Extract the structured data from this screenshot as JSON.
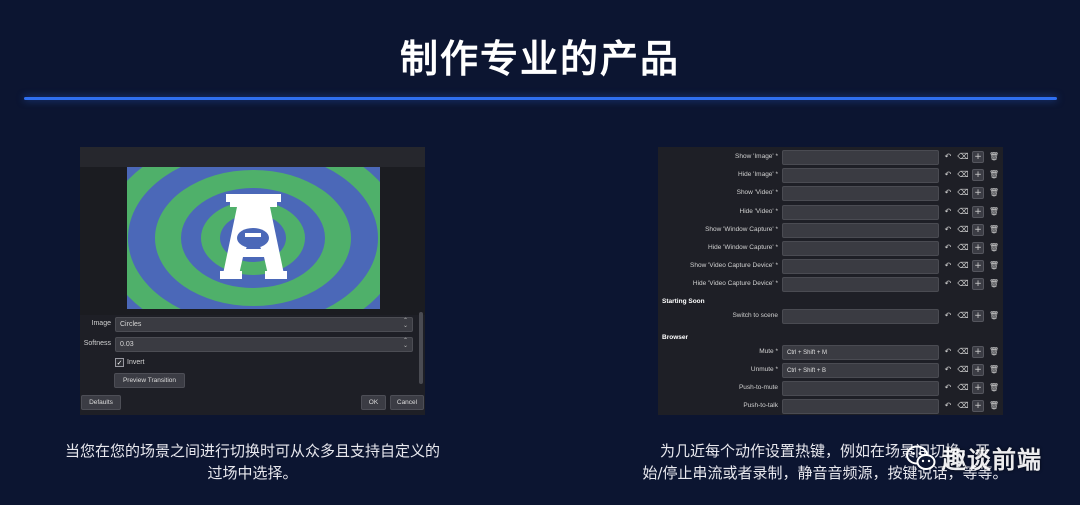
{
  "header": {
    "title": "制作专业的产品"
  },
  "left": {
    "image_label": "Image",
    "image_value": "Circles",
    "softness_label": "Softness",
    "softness_value": "0.03",
    "invert_label": "Invert",
    "invert_checked": true,
    "preview_button": "Preview Transition",
    "defaults_button": "Defaults",
    "ok_button": "OK",
    "cancel_button": "Cancel",
    "caption_line1": "当您在您的场景之间进行切换时可从众多且支持自定义的",
    "caption_line2": "过场中选择。"
  },
  "right": {
    "rows": [
      {
        "label": "Show 'Image' *",
        "value": ""
      },
      {
        "label": "Hide 'Image' *",
        "value": ""
      },
      {
        "label": "Show 'Video' *",
        "value": ""
      },
      {
        "label": "Hide 'Video' *",
        "value": ""
      },
      {
        "label": "Show 'Window Capture' *",
        "value": ""
      },
      {
        "label": "Hide 'Window Capture' *",
        "value": ""
      },
      {
        "label": "Show 'Video Capture Device' *",
        "value": ""
      },
      {
        "label": "Hide 'Video Capture Device' *",
        "value": ""
      }
    ],
    "section1": "Starting Soon",
    "section1_rows": [
      {
        "label": "Switch to scene",
        "value": ""
      }
    ],
    "section2": "Browser",
    "section2_rows": [
      {
        "label": "Mute *",
        "value": "Ctrl + Shift + M"
      },
      {
        "label": "Unmute *",
        "value": "Ctrl + Shift + B"
      },
      {
        "label": "Push-to-mute",
        "value": ""
      },
      {
        "label": "Push-to-talk",
        "value": ""
      }
    ],
    "caption_line1": "为几近每个动作设置热键，例如在场景间切换，开",
    "caption_line2": "始/停止串流或者录制，静音音频源，按键说话，等等。"
  },
  "watermark": {
    "text": "趣谈前端"
  },
  "colors": {
    "background": "#0c1531",
    "accent": "#2f6ff0",
    "panel": "#1e1f26",
    "green": "#4fb06a",
    "blue": "#4b68b8"
  }
}
